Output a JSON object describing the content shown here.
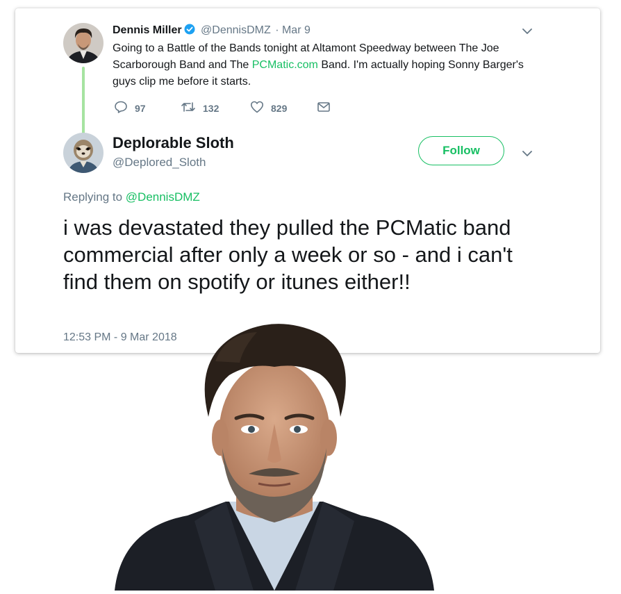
{
  "tweet1": {
    "author_name": "Dennis Miller",
    "handle": "@DennisDMZ",
    "date": "· Mar 9",
    "text_before_link": "Going to a Battle of the Bands tonight at Altamont Speedway between The Joe Scarborough Band and The ",
    "link": "PCMatic.com",
    "text_after_link": " Band. I'm actually hoping Sonny Barger's guys clip me before it starts.",
    "reply_count": "97",
    "retweet_count": "132",
    "like_count": "829"
  },
  "tweet2": {
    "author_name": "Deplorable Sloth",
    "handle": "@Deplored_Sloth",
    "follow_label": "Follow",
    "replying_prefix": "Replying to ",
    "replying_handle": "@DennisDMZ",
    "text": "i was devastated they pulled the PCMatic band commercial after only a week or so - and i can't find them on spotify or itunes either!!",
    "timestamp": "12:53 PM - 9 Mar 2018"
  },
  "colors": {
    "accent": "#17bf63",
    "secondary_text": "#657786",
    "thread_line": "#a6e3a1"
  },
  "icons": [
    "verified-badge-icon",
    "chevron-down-icon",
    "reply-icon",
    "retweet-icon",
    "like-icon",
    "direct-message-icon"
  ]
}
